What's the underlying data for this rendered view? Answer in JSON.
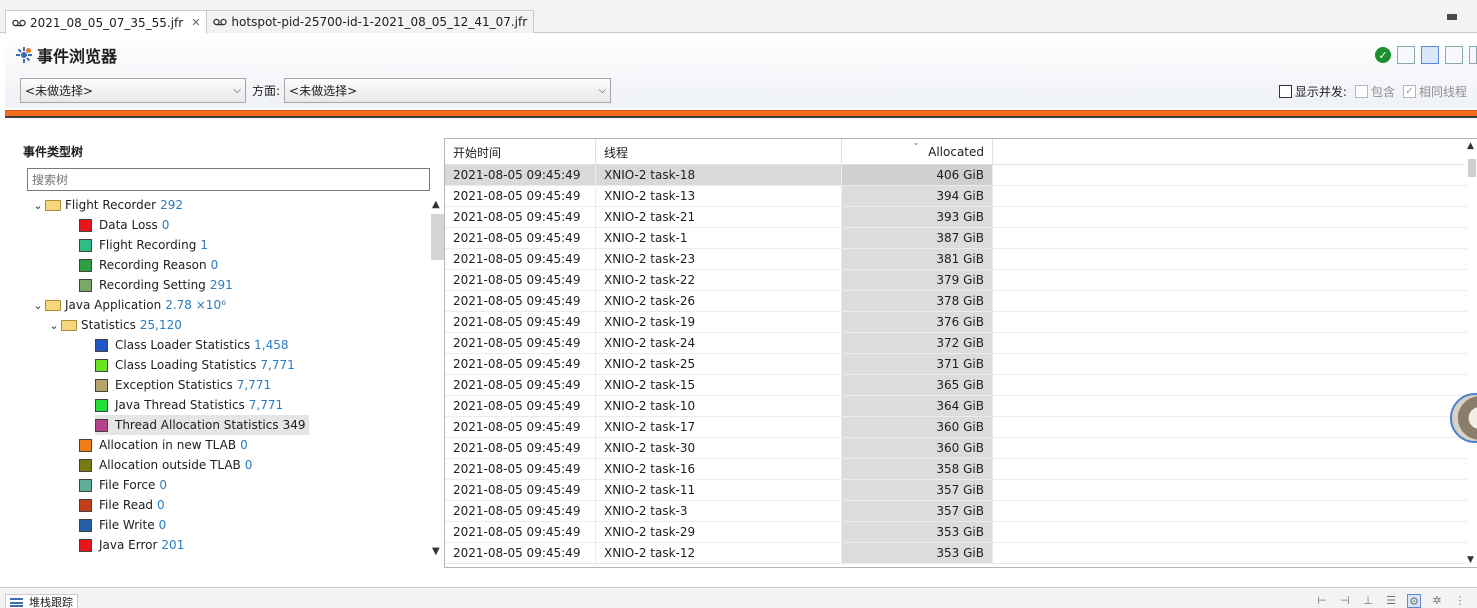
{
  "tabs": [
    {
      "label": "2021_08_05_07_35_55.jfr",
      "active": true,
      "closable": true
    },
    {
      "label": "hotspot-pid-25700-id-1-2021_08_05_12_41_07.jfr",
      "active": false,
      "closable": false
    }
  ],
  "page_title": "事件浏览器",
  "selectors": {
    "first_value": "<未做选择>",
    "facet_label": "方面:",
    "facet_value": "<未做选择>"
  },
  "options": {
    "show_concurrent": "显示并发:",
    "contains": "包含",
    "same_thread": "相同线程"
  },
  "event_tree": {
    "header": "事件类型树",
    "search_placeholder": "搜索树",
    "nodes": [
      {
        "label": "Flight Recorder",
        "count": "292",
        "level": 0,
        "expandable": true,
        "color": ""
      },
      {
        "label": "Data Loss",
        "count": "0",
        "level": 1,
        "expandable": false,
        "color": "#e8141a"
      },
      {
        "label": "Flight Recording",
        "count": "1",
        "level": 1,
        "expandable": false,
        "color": "#2ebd83"
      },
      {
        "label": "Recording Reason",
        "count": "0",
        "level": 1,
        "expandable": false,
        "color": "#2f9e45"
      },
      {
        "label": "Recording Setting",
        "count": "291",
        "level": 1,
        "expandable": false,
        "color": "#78a86a"
      },
      {
        "label": "Java Application",
        "count": "2.78 ×10⁶",
        "level": 0,
        "expandable": true,
        "color": ""
      },
      {
        "label": "Statistics",
        "count": "25,120",
        "level": 1,
        "expandable": true,
        "color": ""
      },
      {
        "label": "Class Loader Statistics",
        "count": "1,458",
        "level": 2,
        "expandable": false,
        "color": "#2455c6"
      },
      {
        "label": "Class Loading Statistics",
        "count": "7,771",
        "level": 2,
        "expandable": false,
        "color": "#6ae320"
      },
      {
        "label": "Exception Statistics",
        "count": "7,771",
        "level": 2,
        "expandable": false,
        "color": "#b5a46d"
      },
      {
        "label": "Java Thread Statistics",
        "count": "7,771",
        "level": 2,
        "expandable": false,
        "color": "#22e03a"
      },
      {
        "label": "Thread Allocation Statistics",
        "count": "349",
        "level": 2,
        "expandable": false,
        "color": "#b5438c",
        "selected": true
      },
      {
        "label": "Allocation in new TLAB",
        "count": "0",
        "level": 1,
        "expandable": false,
        "color": "#f07e18"
      },
      {
        "label": "Allocation outside TLAB",
        "count": "0",
        "level": 1,
        "expandable": false,
        "color": "#7a7a14"
      },
      {
        "label": "File Force",
        "count": "0",
        "level": 1,
        "expandable": false,
        "color": "#5fae9a"
      },
      {
        "label": "File Read",
        "count": "0",
        "level": 1,
        "expandable": false,
        "color": "#c0401c"
      },
      {
        "label": "File Write",
        "count": "0",
        "level": 1,
        "expandable": false,
        "color": "#2460a8"
      },
      {
        "label": "Java Error",
        "count": "201",
        "level": 1,
        "expandable": false,
        "color": "#e8141a"
      }
    ]
  },
  "table": {
    "columns": [
      "开始时间",
      "线程",
      "Allocated"
    ],
    "rows": [
      {
        "start": "2021-08-05 09:45:49",
        "thread": "XNIO-2 task-18",
        "allocated": "406 GiB"
      },
      {
        "start": "2021-08-05 09:45:49",
        "thread": "XNIO-2 task-13",
        "allocated": "394 GiB"
      },
      {
        "start": "2021-08-05 09:45:49",
        "thread": "XNIO-2 task-21",
        "allocated": "393 GiB"
      },
      {
        "start": "2021-08-05 09:45:49",
        "thread": "XNIO-2 task-1",
        "allocated": "387 GiB"
      },
      {
        "start": "2021-08-05 09:45:49",
        "thread": "XNIO-2 task-23",
        "allocated": "381 GiB"
      },
      {
        "start": "2021-08-05 09:45:49",
        "thread": "XNIO-2 task-22",
        "allocated": "379 GiB"
      },
      {
        "start": "2021-08-05 09:45:49",
        "thread": "XNIO-2 task-26",
        "allocated": "378 GiB"
      },
      {
        "start": "2021-08-05 09:45:49",
        "thread": "XNIO-2 task-19",
        "allocated": "376 GiB"
      },
      {
        "start": "2021-08-05 09:45:49",
        "thread": "XNIO-2 task-24",
        "allocated": "372 GiB"
      },
      {
        "start": "2021-08-05 09:45:49",
        "thread": "XNIO-2 task-25",
        "allocated": "371 GiB"
      },
      {
        "start": "2021-08-05 09:45:49",
        "thread": "XNIO-2 task-15",
        "allocated": "365 GiB"
      },
      {
        "start": "2021-08-05 09:45:49",
        "thread": "XNIO-2 task-10",
        "allocated": "364 GiB"
      },
      {
        "start": "2021-08-05 09:45:49",
        "thread": "XNIO-2 task-17",
        "allocated": "360 GiB"
      },
      {
        "start": "2021-08-05 09:45:49",
        "thread": "XNIO-2 task-30",
        "allocated": "360 GiB"
      },
      {
        "start": "2021-08-05 09:45:49",
        "thread": "XNIO-2 task-16",
        "allocated": "358 GiB"
      },
      {
        "start": "2021-08-05 09:45:49",
        "thread": "XNIO-2 task-11",
        "allocated": "357 GiB"
      },
      {
        "start": "2021-08-05 09:45:49",
        "thread": "XNIO-2 task-3",
        "allocated": "357 GiB"
      },
      {
        "start": "2021-08-05 09:45:49",
        "thread": "XNIO-2 task-29",
        "allocated": "353 GiB"
      },
      {
        "start": "2021-08-05 09:45:49",
        "thread": "XNIO-2 task-12",
        "allocated": "353 GiB"
      }
    ]
  },
  "bottom_tab": "堆栈跟踪",
  "colors": {
    "accent_bar": "#f26d1d",
    "count_text": "#2a7bbf",
    "selection": "#d9d9d9"
  }
}
